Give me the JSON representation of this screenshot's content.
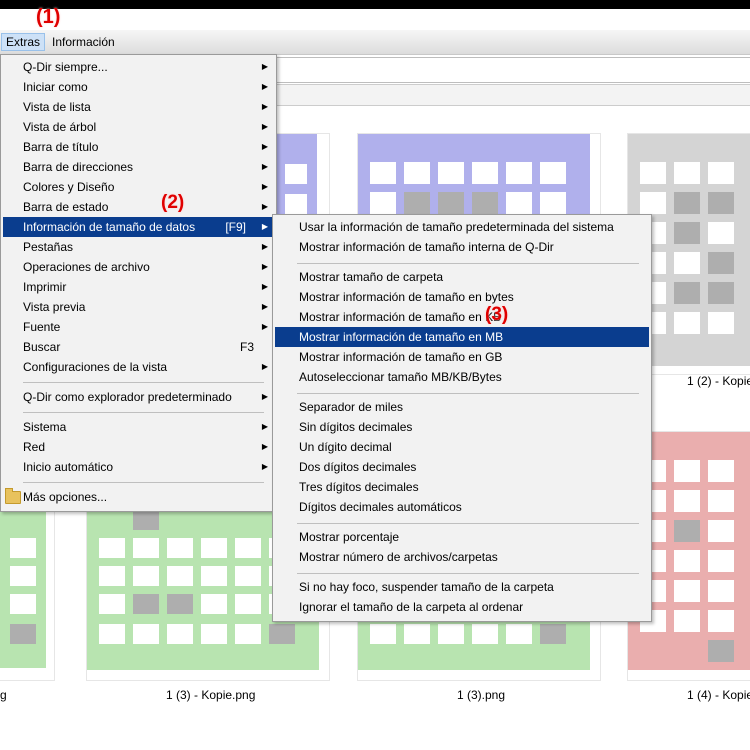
{
  "menubar": {
    "extras": "Extras",
    "info": "Información"
  },
  "markers": {
    "m1": "(1)",
    "m2": "(2)",
    "m3": "(3)"
  },
  "main_menu": {
    "items": [
      "Q-Dir siempre...",
      "Iniciar como",
      "Vista de lista",
      "Vista de árbol",
      "Barra de título",
      "Barra de direcciones",
      "Colores y Diseño",
      "Barra de estado",
      "Información de tamaño de datos",
      "Pestañas",
      "Operaciones de archivo",
      "Imprimir",
      "Vista previa",
      "Fuente",
      "Buscar",
      "Configuraciones de la vista",
      "Q-Dir como explorador predeterminado",
      "Sistema",
      "Red",
      "Inicio automático",
      "Más opciones..."
    ],
    "shortcut_size": "[F9]",
    "shortcut_search": "F3"
  },
  "sub_menu": {
    "items": [
      "Usar la información de tamaño predeterminada del sistema",
      "Mostrar información de tamaño interna de Q-Dir",
      "Mostrar tamaño de carpeta",
      "Mostrar información de tamaño en bytes",
      "Mostrar información de tamaño en KB",
      "Mostrar información de tamaño en MB",
      "Mostrar información de tamaño en GB",
      "Autoseleccionar tamaño MB/KB/Bytes",
      "Separador de miles",
      "Sin dígitos decimales",
      "Un dígito decimal",
      "Dos dígitos decimales",
      "Tres dígitos decimales",
      "Dígitos decimales automáticos",
      "Mostrar porcentaje",
      "Mostrar número de archivos/carpetas",
      "Si no hay foco, suspender tamaño de la carpeta",
      "Ignorar el tamaño de la carpeta al ordenar"
    ]
  },
  "files": {
    "f1": "1 (2) - Kopie",
    "f2": "g",
    "f3": "1 (3) - Kopie.png",
    "f4": "1 (3).png",
    "f5": "1 (4) - Kopie"
  },
  "colors": {
    "blue": "#b0b0ec",
    "gray": "#d4d4d4",
    "green": "#b8e4b0",
    "red": "#eaaeae",
    "cell_dark": "#aeaeae",
    "selection": "#0a3d8e"
  }
}
